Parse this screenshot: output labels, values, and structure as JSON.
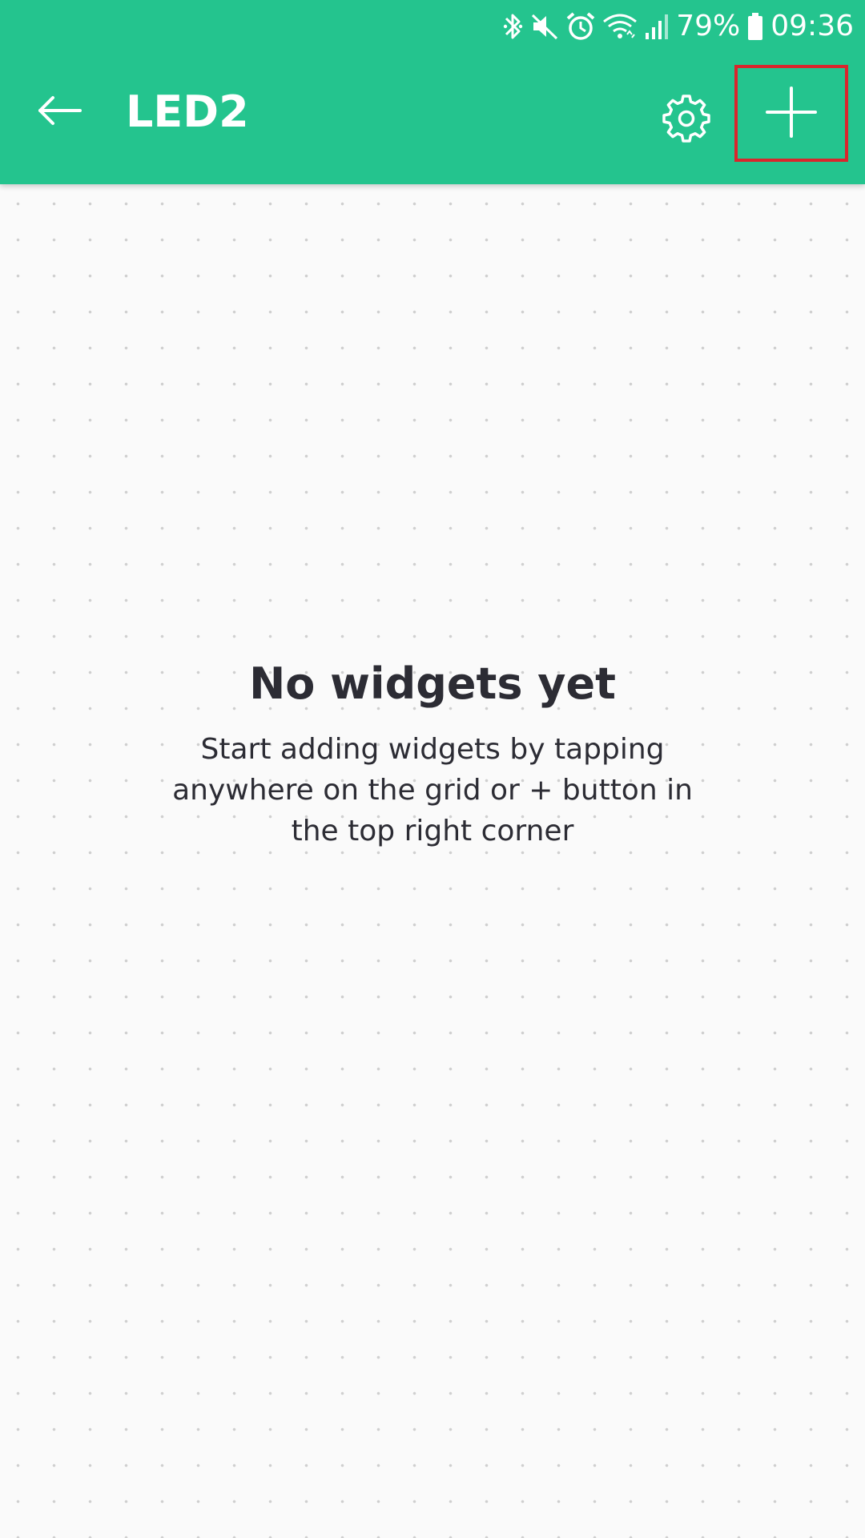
{
  "status_bar": {
    "battery_percent_text": "79%",
    "time": "09:36",
    "icons": [
      "bluetooth-icon",
      "mute-icon",
      "alarm-icon",
      "wifi-icon",
      "signal-icon",
      "battery-icon"
    ]
  },
  "app_bar": {
    "title": "LED2",
    "back_icon": "arrow-left-icon",
    "settings_icon": "gear-icon",
    "add_icon": "plus-icon",
    "color": "#24c48e"
  },
  "empty_state": {
    "title": "No widgets yet",
    "description": "Start adding widgets by tapping anywhere on the grid or + button in the top right corner"
  },
  "colors": {
    "accent": "#24c48e",
    "highlight_box": "#d9262c",
    "background": "#fafafa",
    "text_dark": "#2c2c34"
  }
}
